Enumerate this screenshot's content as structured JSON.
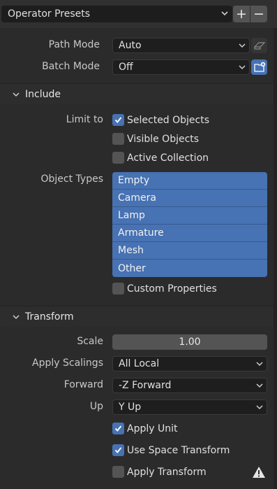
{
  "presets": {
    "select_label": "Operator Presets",
    "add_label": "+",
    "remove_label": "−"
  },
  "path_mode": {
    "label": "Path Mode",
    "value": "Auto"
  },
  "batch_mode": {
    "label": "Batch Mode",
    "value": "Off"
  },
  "include": {
    "title": "Include",
    "limit_to_label": "Limit to",
    "limit_options": [
      {
        "label": "Selected Objects",
        "checked": true
      },
      {
        "label": "Visible Objects",
        "checked": false
      },
      {
        "label": "Active Collection",
        "checked": false
      }
    ],
    "object_types_label": "Object Types",
    "object_types": [
      "Empty",
      "Camera",
      "Lamp",
      "Armature",
      "Mesh",
      "Other"
    ],
    "custom_properties": {
      "label": "Custom Properties",
      "checked": false
    }
  },
  "transform": {
    "title": "Transform",
    "scale": {
      "label": "Scale",
      "value": "1.00"
    },
    "apply_scalings": {
      "label": "Apply Scalings",
      "value": "All Local"
    },
    "forward": {
      "label": "Forward",
      "value": "-Z Forward"
    },
    "up": {
      "label": "Up",
      "value": "Y Up"
    },
    "apply_unit": {
      "label": "Apply Unit",
      "checked": true
    },
    "use_space_transform": {
      "label": "Use Space Transform",
      "checked": true
    },
    "apply_transform": {
      "label": "Apply Transform",
      "checked": false
    }
  },
  "colors": {
    "accent": "#4772b3",
    "panel": "#2b2b2b",
    "field": "#1e1e1e",
    "warning_icon": "#e6e6e6"
  },
  "icons": {
    "path_mode_extra": "eraser-icon",
    "batch_mode_extra": "new-folder-icon",
    "warning": "warning-icon"
  }
}
